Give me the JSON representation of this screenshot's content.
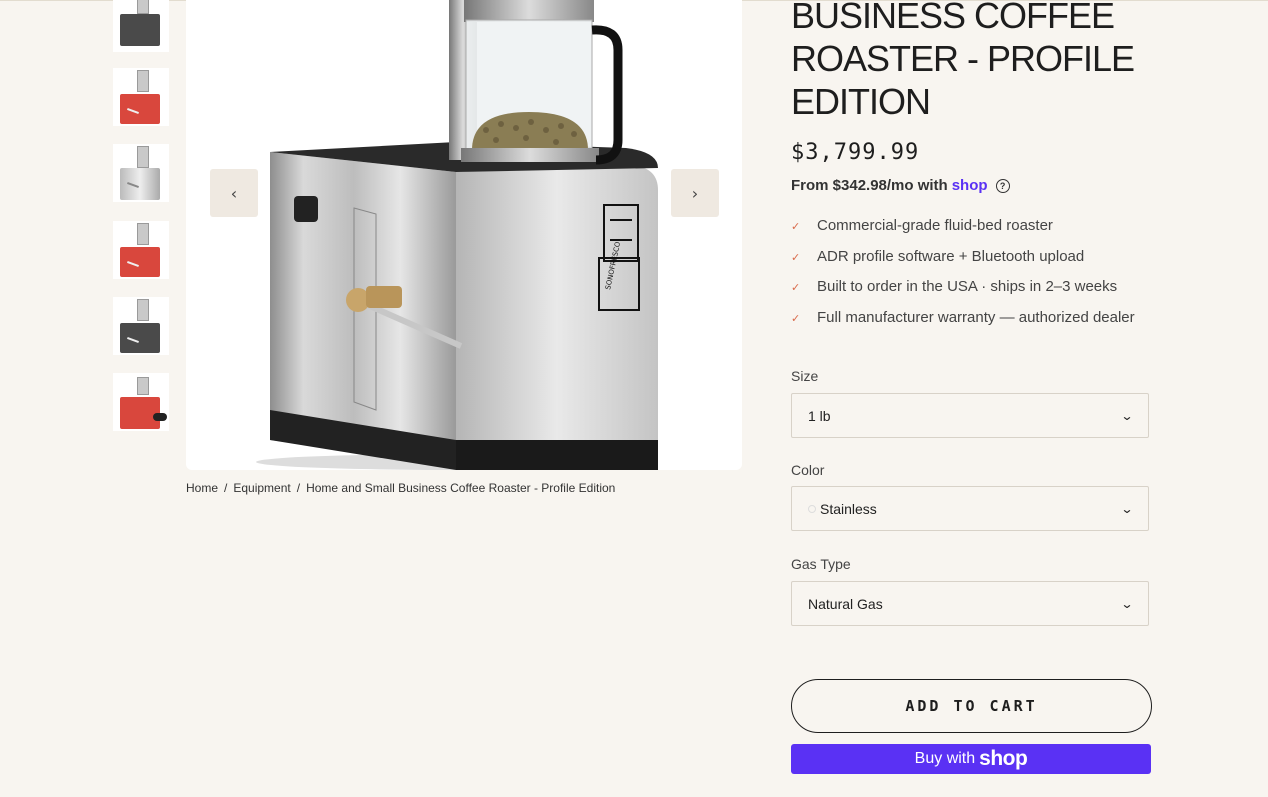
{
  "product": {
    "title": "Business Coffee Roaster - Profile Edition",
    "price": "$3,799.99",
    "installments_text": "From $342.98/mo with",
    "installments_provider": "shop"
  },
  "features": [
    "Commercial-grade fluid-bed roaster",
    "ADR profile software + Bluetooth upload",
    "Built to order in the USA · ships in 2–3 weeks",
    "Full manufacturer warranty — authorized dealer"
  ],
  "options": {
    "size": {
      "label": "Size",
      "value": "1 lb"
    },
    "color": {
      "label": "Color",
      "value": "Stainless"
    },
    "gas": {
      "label": "Gas Type",
      "value": "Natural Gas"
    }
  },
  "actions": {
    "add_to_cart": "ADD TO CART",
    "buy_with": "Buy with",
    "buy_provider": "shop"
  },
  "breadcrumb": {
    "home": "Home",
    "category": "Equipment",
    "current": "Home and Small Business Coffee Roaster - Profile Edition"
  },
  "gallery": {
    "thumbnails": [
      {
        "color": "dark"
      },
      {
        "color": "red"
      },
      {
        "color": "stainless"
      },
      {
        "color": "red"
      },
      {
        "color": "dark"
      },
      {
        "color": "red-annotated"
      }
    ],
    "nav_prev_icon": "chevron-left-icon",
    "nav_next_icon": "chevron-right-icon"
  },
  "colors": {
    "accent_shop": "#5a31f4",
    "check": "#d96a4a",
    "background": "#f8f5f0"
  }
}
